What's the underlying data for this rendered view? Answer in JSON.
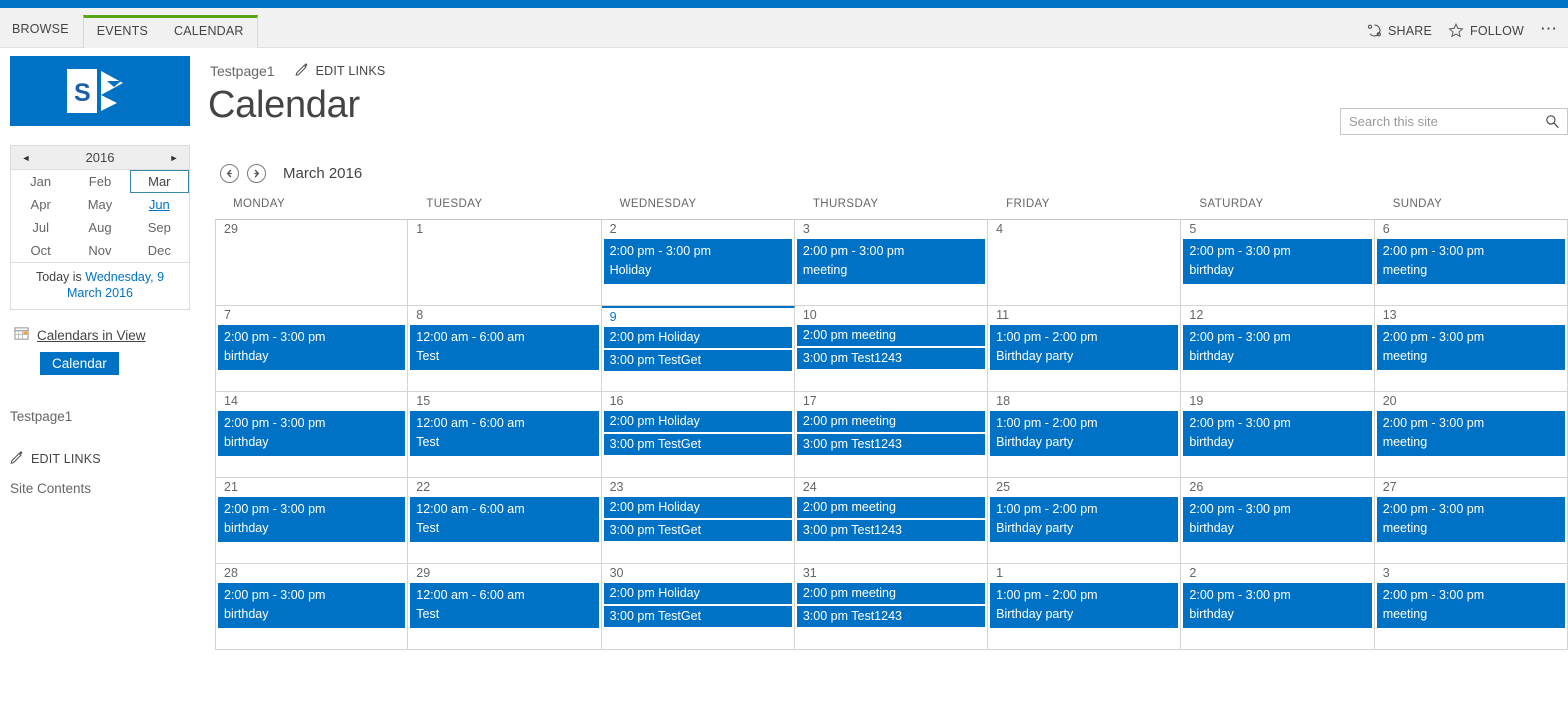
{
  "ribbon": {
    "browse_tab": "BROWSE",
    "tabs": [
      {
        "label": "EVENTS"
      },
      {
        "label": "CALENDAR"
      }
    ],
    "share_label": "SHARE",
    "follow_label": "FOLLOW",
    "ellipsis": "⋯"
  },
  "header": {
    "site_link": "Testpage1",
    "edit_links_label": "EDIT LINKS",
    "page_title": "Calendar"
  },
  "search": {
    "placeholder": "Search this site",
    "value": ""
  },
  "mini_calendar": {
    "prev_arrow": "◄",
    "next_arrow": "►",
    "year": "2016",
    "months": [
      {
        "label": "Jan",
        "state": "normal"
      },
      {
        "label": "Feb",
        "state": "normal"
      },
      {
        "label": "Mar",
        "state": "selected"
      },
      {
        "label": "Apr",
        "state": "normal"
      },
      {
        "label": "May",
        "state": "normal"
      },
      {
        "label": "Jun",
        "state": "linked"
      },
      {
        "label": "Jul",
        "state": "normal"
      },
      {
        "label": "Aug",
        "state": "normal"
      },
      {
        "label": "Sep",
        "state": "normal"
      },
      {
        "label": "Oct",
        "state": "normal"
      },
      {
        "label": "Nov",
        "state": "normal"
      },
      {
        "label": "Dec",
        "state": "normal"
      }
    ],
    "today_prefix": "Today is ",
    "today_date": "Wednesday, 9 March 2016"
  },
  "left_nav": {
    "calendars_in_view_label": "Calendars in View",
    "calendar_chip": "Calendar",
    "site_name": "Testpage1",
    "edit_links": "EDIT LINKS",
    "site_contents": "Site Contents"
  },
  "calendar": {
    "prev_label": "←",
    "next_label": "→",
    "month_label": "March 2016",
    "day_headers": [
      "MONDAY",
      "TUESDAY",
      "WEDNESDAY",
      "THURSDAY",
      "FRIDAY",
      "SATURDAY",
      "SUNDAY"
    ],
    "accent_color": "#0072C6",
    "weeks": [
      [
        {
          "day": "29",
          "today": false,
          "events": []
        },
        {
          "day": "1",
          "today": false,
          "events": []
        },
        {
          "day": "2",
          "today": false,
          "events": [
            {
              "lines": [
                "2:00 pm - 3:00 pm",
                "Holiday"
              ]
            }
          ]
        },
        {
          "day": "3",
          "today": false,
          "events": [
            {
              "lines": [
                "2:00 pm - 3:00 pm",
                "meeting"
              ]
            }
          ]
        },
        {
          "day": "4",
          "today": false,
          "events": []
        },
        {
          "day": "5",
          "today": false,
          "events": [
            {
              "lines": [
                "2:00 pm - 3:00 pm",
                "birthday"
              ]
            }
          ]
        },
        {
          "day": "6",
          "today": false,
          "events": [
            {
              "lines": [
                "2:00 pm - 3:00 pm",
                "meeting"
              ]
            }
          ]
        }
      ],
      [
        {
          "day": "7",
          "today": false,
          "events": [
            {
              "lines": [
                "2:00 pm - 3:00 pm",
                "birthday"
              ]
            }
          ]
        },
        {
          "day": "8",
          "today": false,
          "events": [
            {
              "lines": [
                "12:00 am - 6:00 am",
                "Test"
              ]
            }
          ]
        },
        {
          "day": "9",
          "today": true,
          "events": [
            {
              "compact": true,
              "lines": [
                "2:00 pm Holiday"
              ]
            },
            {
              "compact": true,
              "lines": [
                "3:00 pm TestGet"
              ]
            }
          ]
        },
        {
          "day": "10",
          "today": false,
          "events": [
            {
              "compact": true,
              "lines": [
                "2:00 pm meeting"
              ]
            },
            {
              "compact": true,
              "lines": [
                "3:00 pm Test1243"
              ]
            }
          ]
        },
        {
          "day": "11",
          "today": false,
          "events": [
            {
              "lines": [
                "1:00 pm - 2:00 pm",
                "Birthday party"
              ]
            }
          ]
        },
        {
          "day": "12",
          "today": false,
          "events": [
            {
              "lines": [
                "2:00 pm - 3:00 pm",
                "birthday"
              ]
            }
          ]
        },
        {
          "day": "13",
          "today": false,
          "events": [
            {
              "lines": [
                "2:00 pm - 3:00 pm",
                "meeting"
              ]
            }
          ]
        }
      ],
      [
        {
          "day": "14",
          "today": false,
          "events": [
            {
              "lines": [
                "2:00 pm - 3:00 pm",
                "birthday"
              ]
            }
          ]
        },
        {
          "day": "15",
          "today": false,
          "events": [
            {
              "lines": [
                "12:00 am - 6:00 am",
                "Test"
              ]
            }
          ]
        },
        {
          "day": "16",
          "today": false,
          "events": [
            {
              "compact": true,
              "lines": [
                "2:00 pm Holiday"
              ]
            },
            {
              "compact": true,
              "lines": [
                "3:00 pm TestGet"
              ]
            }
          ]
        },
        {
          "day": "17",
          "today": false,
          "events": [
            {
              "compact": true,
              "lines": [
                "2:00 pm meeting"
              ]
            },
            {
              "compact": true,
              "lines": [
                "3:00 pm Test1243"
              ]
            }
          ]
        },
        {
          "day": "18",
          "today": false,
          "events": [
            {
              "lines": [
                "1:00 pm - 2:00 pm",
                "Birthday party"
              ]
            }
          ]
        },
        {
          "day": "19",
          "today": false,
          "events": [
            {
              "lines": [
                "2:00 pm - 3:00 pm",
                "birthday"
              ]
            }
          ]
        },
        {
          "day": "20",
          "today": false,
          "events": [
            {
              "lines": [
                "2:00 pm - 3:00 pm",
                "meeting"
              ]
            }
          ]
        }
      ],
      [
        {
          "day": "21",
          "today": false,
          "events": [
            {
              "lines": [
                "2:00 pm - 3:00 pm",
                "birthday"
              ]
            }
          ]
        },
        {
          "day": "22",
          "today": false,
          "events": [
            {
              "lines": [
                "12:00 am - 6:00 am",
                "Test"
              ]
            }
          ]
        },
        {
          "day": "23",
          "today": false,
          "events": [
            {
              "compact": true,
              "lines": [
                "2:00 pm Holiday"
              ]
            },
            {
              "compact": true,
              "lines": [
                "3:00 pm TestGet"
              ]
            }
          ]
        },
        {
          "day": "24",
          "today": false,
          "events": [
            {
              "compact": true,
              "lines": [
                "2:00 pm meeting"
              ]
            },
            {
              "compact": true,
              "lines": [
                "3:00 pm Test1243"
              ]
            }
          ]
        },
        {
          "day": "25",
          "today": false,
          "events": [
            {
              "lines": [
                "1:00 pm - 2:00 pm",
                "Birthday party"
              ]
            }
          ]
        },
        {
          "day": "26",
          "today": false,
          "events": [
            {
              "lines": [
                "2:00 pm - 3:00 pm",
                "birthday"
              ]
            }
          ]
        },
        {
          "day": "27",
          "today": false,
          "events": [
            {
              "lines": [
                "2:00 pm - 3:00 pm",
                "meeting"
              ]
            }
          ]
        }
      ],
      [
        {
          "day": "28",
          "today": false,
          "events": [
            {
              "lines": [
                "2:00 pm - 3:00 pm",
                "birthday"
              ]
            }
          ]
        },
        {
          "day": "29",
          "today": false,
          "events": [
            {
              "lines": [
                "12:00 am - 6:00 am",
                "Test"
              ]
            }
          ]
        },
        {
          "day": "30",
          "today": false,
          "events": [
            {
              "compact": true,
              "lines": [
                "2:00 pm Holiday"
              ]
            },
            {
              "compact": true,
              "lines": [
                "3:00 pm TestGet"
              ]
            }
          ]
        },
        {
          "day": "31",
          "today": false,
          "events": [
            {
              "compact": true,
              "lines": [
                "2:00 pm meeting"
              ]
            },
            {
              "compact": true,
              "lines": [
                "3:00 pm Test1243"
              ]
            }
          ]
        },
        {
          "day": "1",
          "today": false,
          "events": [
            {
              "lines": [
                "1:00 pm - 2:00 pm",
                "Birthday party"
              ]
            }
          ]
        },
        {
          "day": "2",
          "today": false,
          "events": [
            {
              "lines": [
                "2:00 pm - 3:00 pm",
                "birthday"
              ]
            }
          ]
        },
        {
          "day": "3",
          "today": false,
          "events": [
            {
              "lines": [
                "2:00 pm - 3:00 pm",
                "meeting"
              ]
            }
          ]
        }
      ]
    ]
  }
}
